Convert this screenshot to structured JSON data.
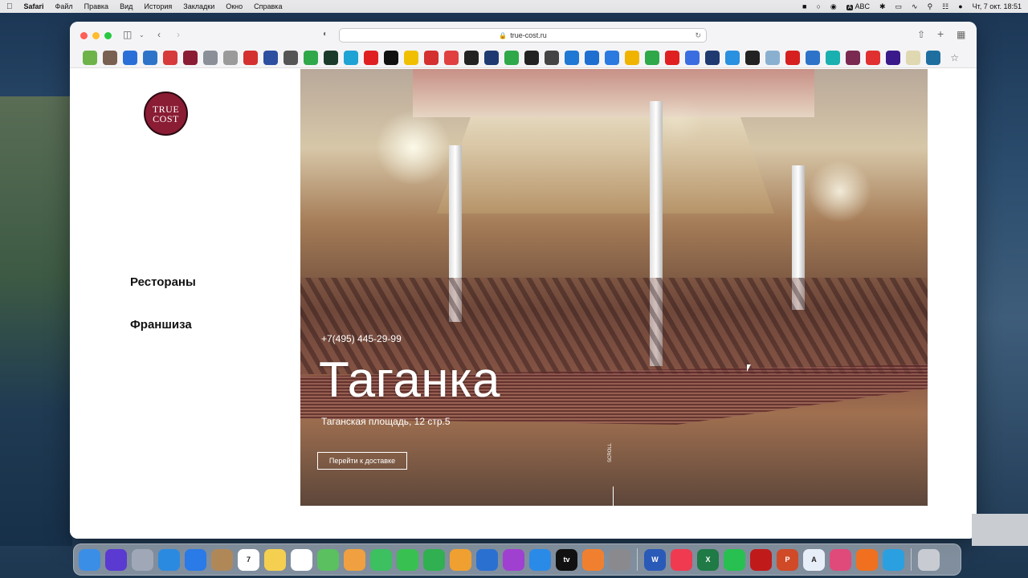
{
  "menubar": {
    "app": "Safari",
    "items": [
      "Файл",
      "Правка",
      "Вид",
      "История",
      "Закладки",
      "Окно",
      "Справка"
    ],
    "keyboard": "ABC",
    "clock": "Чт, 7 окт.  18:51"
  },
  "browser": {
    "url": "true-cost.ru",
    "favorites": [
      {
        "icon": "leaf-icon",
        "color": "#6db34a"
      },
      {
        "icon": "grid-icon",
        "color": "#7a6050"
      },
      {
        "icon": "chevron-icon",
        "color": "#2a6fd8"
      },
      {
        "icon": "figure-icon",
        "color": "#2d74c9"
      },
      {
        "icon": "squares-icon",
        "color": "#d63a3a"
      },
      {
        "icon": "circle-icon",
        "color": "#8a1c34"
      },
      {
        "icon": "b-icon",
        "color": "#8a8f98"
      },
      {
        "icon": "rss-icon",
        "color": "#9a9a9a"
      },
      {
        "icon": "bars-icon",
        "color": "#d43030"
      },
      {
        "icon": "ring-icon",
        "color": "#2d4fa0"
      },
      {
        "icon": "text-icon",
        "color": "#555555"
      },
      {
        "icon": "sh-icon",
        "color": "#2fa84a"
      },
      {
        "icon": "box-icon",
        "color": "#1b3b2a"
      },
      {
        "icon": "o-icon",
        "color": "#1fa3d4"
      },
      {
        "icon": "youtube-icon",
        "color": "#e02020"
      },
      {
        "icon": "plus-icon",
        "color": "#111111"
      },
      {
        "icon": "x-icon",
        "color": "#f0c000"
      },
      {
        "icon": "go-icon",
        "color": "#d43030"
      },
      {
        "icon": "kanji-icon",
        "color": "#e04040"
      },
      {
        "icon": "chart-icon",
        "color": "#222222"
      },
      {
        "icon": "square-icon",
        "color": "#1e3a70"
      },
      {
        "icon": "check-icon",
        "color": "#2fa84a"
      },
      {
        "icon": "amazon-icon",
        "color": "#222222"
      },
      {
        "icon": "lines-icon",
        "color": "#444444"
      },
      {
        "icon": "info-icon",
        "color": "#1e78d4"
      },
      {
        "icon": "tile-icon",
        "color": "#1e6fd0"
      },
      {
        "icon": "camera-icon",
        "color": "#2a7ae0"
      },
      {
        "icon": "drive-icon",
        "color": "#f0b400"
      },
      {
        "icon": "dots-icon",
        "color": "#2fa84a"
      },
      {
        "icon": "play-icon",
        "color": "#e02020"
      },
      {
        "icon": "doc-icon",
        "color": "#3a6ee0"
      },
      {
        "icon": "y-icon",
        "color": "#1e3a70"
      },
      {
        "icon": "windows-icon",
        "color": "#2a90e0"
      },
      {
        "icon": "amazon-icon",
        "color": "#222222"
      },
      {
        "icon": "pin-icon",
        "color": "#8ab0d0"
      },
      {
        "icon": "hh-icon",
        "color": "#d62020"
      },
      {
        "icon": "figure-icon",
        "color": "#2d74c9"
      },
      {
        "icon": "teal-icon",
        "color": "#1ab0b0"
      },
      {
        "icon": "gear-icon",
        "color": "#7a2a50"
      },
      {
        "icon": "shield-icon",
        "color": "#e03030"
      },
      {
        "icon": "purple-icon",
        "color": "#3a1a8a"
      },
      {
        "icon": "page-icon",
        "color": "#e0d8b0"
      },
      {
        "icon": "arrow-icon",
        "color": "#1e6fa0"
      }
    ]
  },
  "site": {
    "logo": {
      "line1": "TRUE",
      "line2": "COST"
    },
    "nav": [
      "Рестораны",
      "Франшиза"
    ],
    "hero": {
      "phone": "+7(495) 445-29-99",
      "title": "Таганка",
      "address": "Таганская площадь, 12 стр.5",
      "button": "Перейти к доставке",
      "side_label": "SCROLL"
    }
  },
  "dock": {
    "apps": [
      {
        "name": "finder-icon",
        "color": "#3a8ee6",
        "label": ""
      },
      {
        "name": "siri-icon",
        "color": "#5a3ad0",
        "label": ""
      },
      {
        "name": "launchpad-icon",
        "color": "#a0a8b8",
        "label": ""
      },
      {
        "name": "safari-icon",
        "color": "#2a8ae0",
        "label": ""
      },
      {
        "name": "mail-icon",
        "color": "#2a7ae8",
        "label": ""
      },
      {
        "name": "contacts-icon",
        "color": "#b08858",
        "label": ""
      },
      {
        "name": "calendar-icon",
        "color": "#ffffff",
        "label": "7"
      },
      {
        "name": "notes-icon",
        "color": "#f5d050",
        "label": ""
      },
      {
        "name": "reminders-icon",
        "color": "#ffffff",
        "label": ""
      },
      {
        "name": "maps-icon",
        "color": "#5ac060",
        "label": ""
      },
      {
        "name": "photos-icon",
        "color": "#f0a040",
        "label": ""
      },
      {
        "name": "messages-icon",
        "color": "#3cc060",
        "label": ""
      },
      {
        "name": "facetime-icon",
        "color": "#38c050",
        "label": ""
      },
      {
        "name": "numbers-icon",
        "color": "#30b050",
        "label": ""
      },
      {
        "name": "pages-icon",
        "color": "#f0a030",
        "label": ""
      },
      {
        "name": "keynote-icon",
        "color": "#2a70d0",
        "label": ""
      },
      {
        "name": "podcasts-icon",
        "color": "#a040d0",
        "label": ""
      },
      {
        "name": "appstore-icon",
        "color": "#2a8ae8",
        "label": ""
      },
      {
        "name": "appletv-icon",
        "color": "#111111",
        "label": "tv"
      },
      {
        "name": "books-icon",
        "color": "#f08030",
        "label": ""
      },
      {
        "name": "settings-icon",
        "color": "#8a8a8e",
        "label": ""
      },
      {
        "name": "word-icon",
        "color": "#2a5ab8",
        "label": "W"
      },
      {
        "name": "music-icon",
        "color": "#f03a50",
        "label": ""
      },
      {
        "name": "excel-icon",
        "color": "#1f7a45",
        "label": "X"
      },
      {
        "name": "whatsapp-icon",
        "color": "#28c050",
        "label": ""
      },
      {
        "name": "acrobat-icon",
        "color": "#c01a1a",
        "label": ""
      },
      {
        "name": "powerpoint-icon",
        "color": "#d04a28",
        "label": "P"
      },
      {
        "name": "translator-icon",
        "color": "#e8eef8",
        "label": "A"
      },
      {
        "name": "affinity-icon",
        "color": "#e04a7a",
        "label": ""
      },
      {
        "name": "infuse-icon",
        "color": "#f07020",
        "label": ""
      },
      {
        "name": "telegram-icon",
        "color": "#2aa0e0",
        "label": ""
      },
      {
        "name": "trash-icon",
        "color": "#c8ccd2",
        "label": ""
      }
    ]
  }
}
